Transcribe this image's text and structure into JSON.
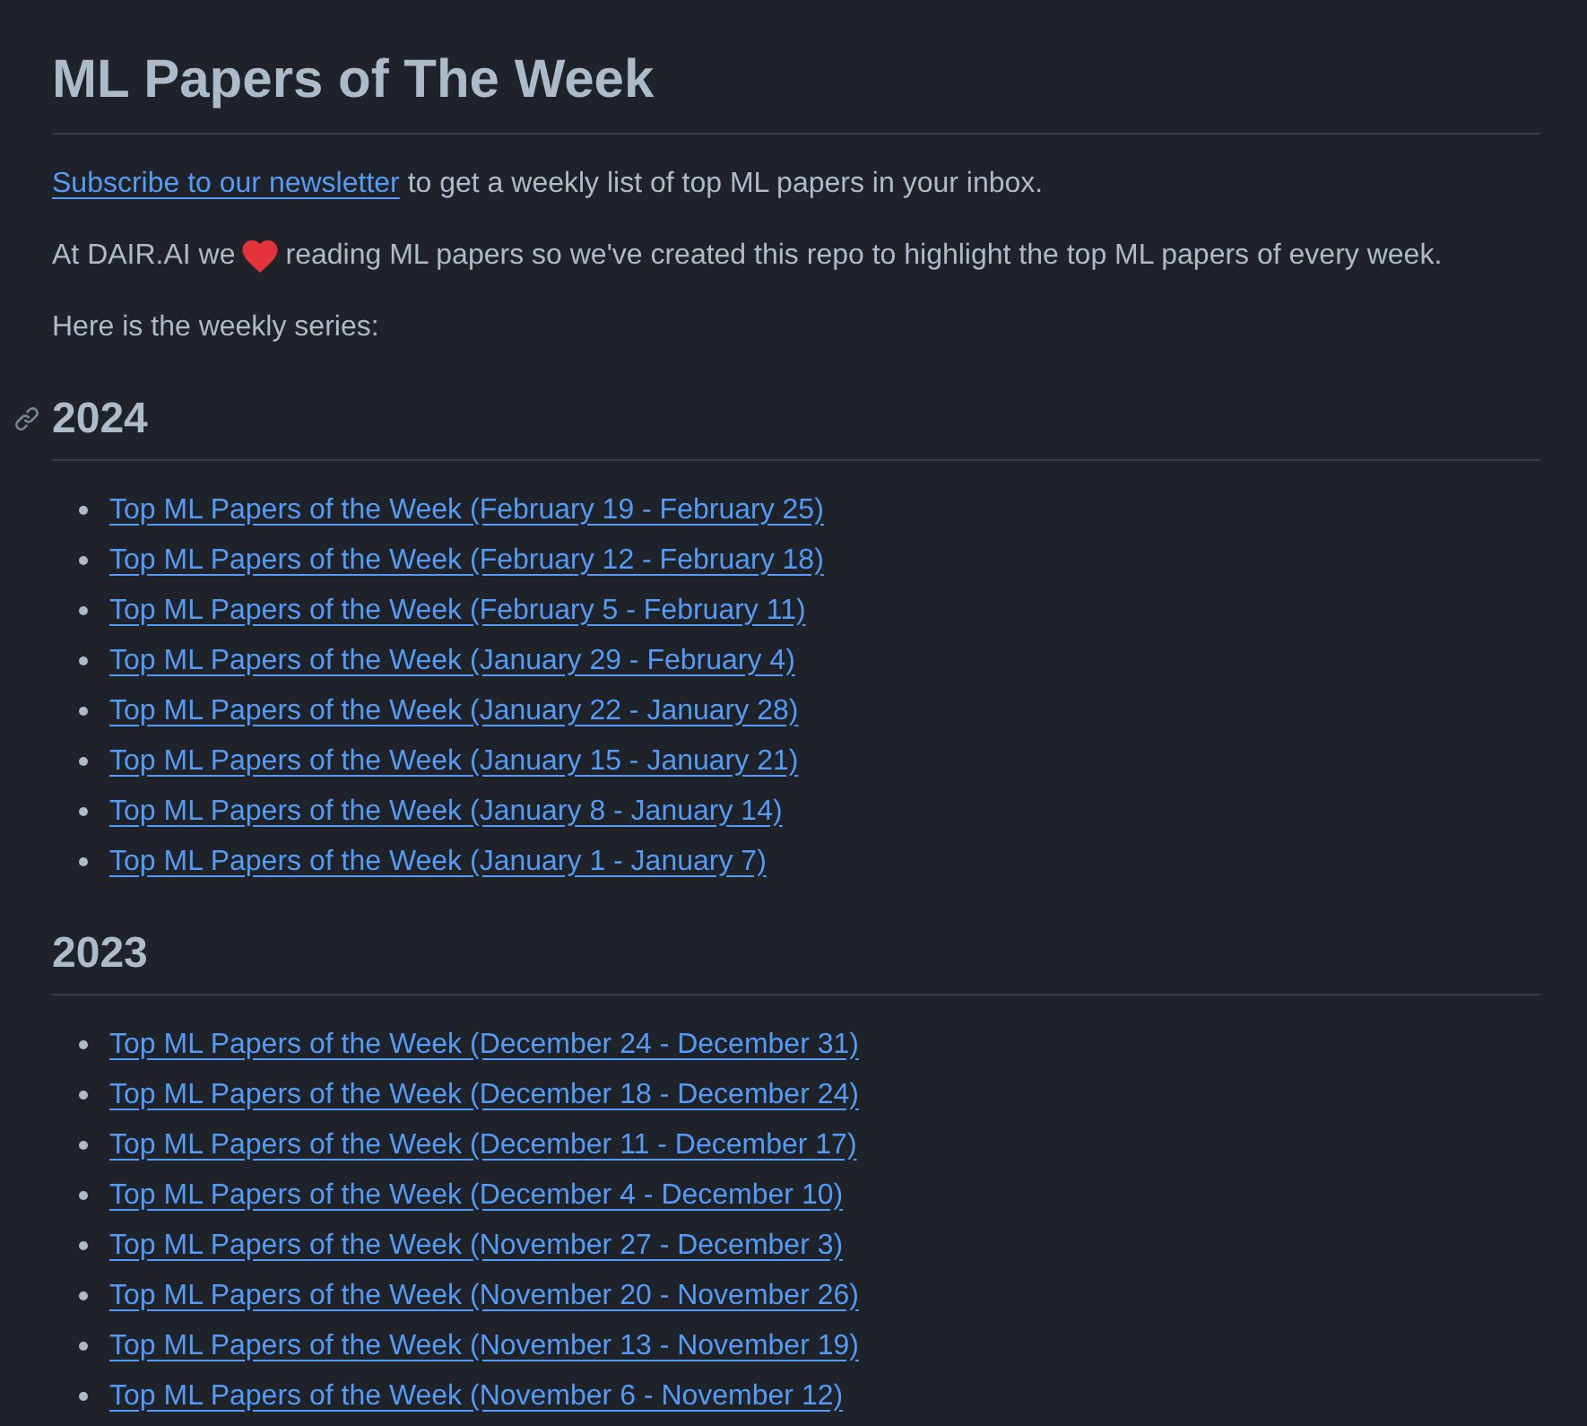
{
  "title": "ML Papers of The Week",
  "newsletter": {
    "link": "Subscribe to our newsletter",
    "text": "to get a weekly list of top ML papers in your inbox."
  },
  "intro": {
    "before": "At DAIR.AI we",
    "after": "reading ML papers so we've created this repo to highlight the top ML papers of every week."
  },
  "series_label": "Here is the weekly series:",
  "sections": [
    {
      "heading": "2024",
      "anchor_visible": true,
      "links": [
        "Top ML Papers of the Week (February 19 - February 25)",
        "Top ML Papers of the Week (February 12 - February 18)",
        "Top ML Papers of the Week (February 5 - February 11)",
        "Top ML Papers of the Week (January 29 - February 4)",
        "Top ML Papers of the Week (January 22 - January 28)",
        "Top ML Papers of the Week (January 15 - January 21)",
        "Top ML Papers of the Week (January 8 - January 14)",
        "Top ML Papers of the Week (January 1 - January 7)"
      ]
    },
    {
      "heading": "2023",
      "anchor_visible": false,
      "links": [
        "Top ML Papers of the Week (December 24 - December 31)",
        "Top ML Papers of the Week (December 18 - December 24)",
        "Top ML Papers of the Week (December 11 - December 17)",
        "Top ML Papers of the Week (December 4 - December 10)",
        "Top ML Papers of the Week (November 27 - December 3)",
        "Top ML Papers of the Week (November 20 - November 26)",
        "Top ML Papers of the Week (November 13 - November 19)",
        "Top ML Papers of the Week (November 6 - November 12)"
      ]
    }
  ]
}
